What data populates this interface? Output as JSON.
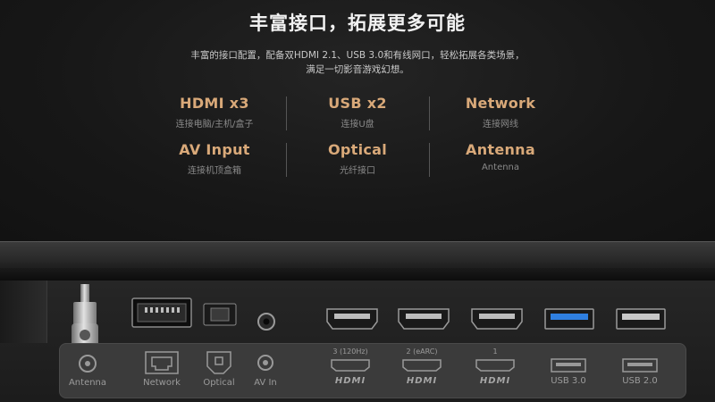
{
  "headline": "丰富接口，拓展更多可能",
  "description": {
    "line1": "丰富的接口配置，配备双HDMI 2.1、USB 3.0和有线网口，轻松拓展各类场景，",
    "line2": "满足一切影音游戏幻想。"
  },
  "specs": [
    {
      "title": "HDMI x3",
      "subtitle": "连接电脑/主机/盒子"
    },
    {
      "title": "USB x2",
      "subtitle": "连接U盘"
    },
    {
      "title": "Network",
      "subtitle": "连接网线"
    },
    {
      "title": "AV Input",
      "subtitle": "连接机顶盒箱"
    },
    {
      "title": "Optical",
      "subtitle": "光纤接口"
    },
    {
      "title": "Antenna",
      "subtitle": "Antenna"
    }
  ],
  "ports": {
    "antenna": "Antenna",
    "network": "Network",
    "optical": "Optical",
    "av_in": "AV In",
    "hdmi3_top": "3 (120Hz)",
    "hdmi2_top": "2 (eARC)",
    "hdmi1_top": "1",
    "hdmi_word": "HDMI",
    "usb3": "USB 3.0",
    "usb2": "USB 2.0"
  },
  "colors": {
    "accent": "#d9a979",
    "usb3_blue": "#2f7fe0",
    "background": "#141414"
  }
}
